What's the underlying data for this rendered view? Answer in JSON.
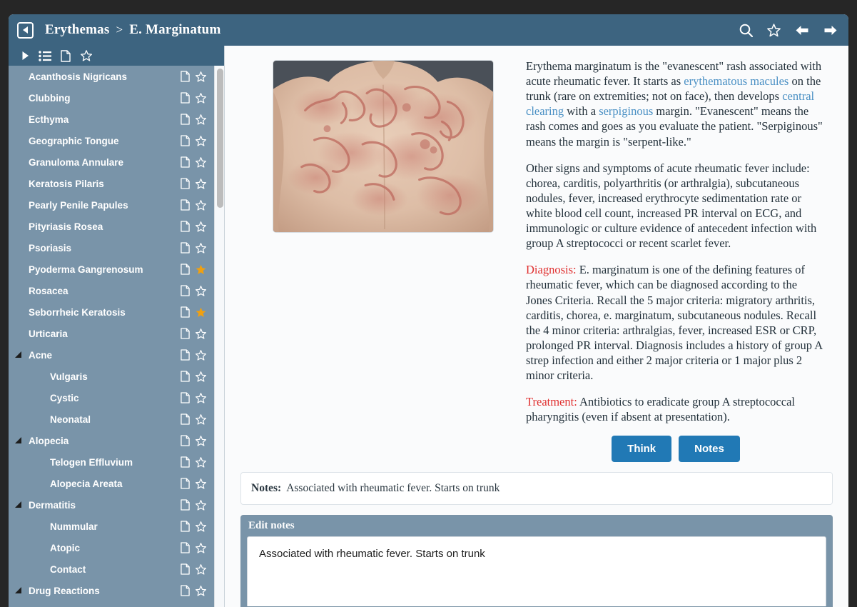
{
  "window": {
    "back_icon": "back-arrow-boxed-icon",
    "breadcrumb": {
      "parent": "Erythemas",
      "separator": ">",
      "current": "E. Marginatum"
    },
    "header_icons": [
      "search-icon",
      "star-icon",
      "arrow-left-icon",
      "arrow-right-icon"
    ],
    "accent": "#3d6480",
    "sidebar_bg": "#7994a9",
    "button_blue": "#2179b5",
    "star_gold": "#f0a010",
    "link_blue": "#4a90c4",
    "keyword_red": "#e03030"
  },
  "sidebar": {
    "toolbar_icons": [
      "expand-triangle-icon",
      "list-icon",
      "document-icon",
      "star-icon"
    ],
    "items": [
      {
        "label": "Acanthosis Nigricans",
        "level": 0,
        "expandable": false,
        "starred": false
      },
      {
        "label": "Clubbing",
        "level": 0,
        "expandable": false,
        "starred": false
      },
      {
        "label": "Ecthyma",
        "level": 0,
        "expandable": false,
        "starred": false
      },
      {
        "label": "Geographic Tongue",
        "level": 0,
        "expandable": false,
        "starred": false
      },
      {
        "label": "Granuloma Annulare",
        "level": 0,
        "expandable": false,
        "starred": false
      },
      {
        "label": "Keratosis Pilaris",
        "level": 0,
        "expandable": false,
        "starred": false
      },
      {
        "label": "Pearly Penile Papules",
        "level": 0,
        "expandable": false,
        "starred": false
      },
      {
        "label": "Pityriasis Rosea",
        "level": 0,
        "expandable": false,
        "starred": false
      },
      {
        "label": "Psoriasis",
        "level": 0,
        "expandable": false,
        "starred": false
      },
      {
        "label": "Pyoderma Gangrenosum",
        "level": 0,
        "expandable": false,
        "starred": true
      },
      {
        "label": "Rosacea",
        "level": 0,
        "expandable": false,
        "starred": false
      },
      {
        "label": "Seborrheic Keratosis",
        "level": 0,
        "expandable": false,
        "starred": true
      },
      {
        "label": "Urticaria",
        "level": 0,
        "expandable": false,
        "starred": false
      },
      {
        "label": "Acne",
        "level": 0,
        "expandable": true,
        "starred": false
      },
      {
        "label": "Vulgaris",
        "level": 1,
        "expandable": false,
        "starred": false
      },
      {
        "label": "Cystic",
        "level": 1,
        "expandable": false,
        "starred": false
      },
      {
        "label": "Neonatal",
        "level": 1,
        "expandable": false,
        "starred": false
      },
      {
        "label": "Alopecia",
        "level": 0,
        "expandable": true,
        "starred": false
      },
      {
        "label": "Telogen Effluvium",
        "level": 1,
        "expandable": false,
        "starred": false
      },
      {
        "label": "Alopecia Areata",
        "level": 1,
        "expandable": false,
        "starred": false
      },
      {
        "label": "Dermatitis",
        "level": 0,
        "expandable": true,
        "starred": false
      },
      {
        "label": "Nummular",
        "level": 1,
        "expandable": false,
        "starred": false
      },
      {
        "label": "Atopic",
        "level": 1,
        "expandable": false,
        "starred": false
      },
      {
        "label": "Contact",
        "level": 1,
        "expandable": false,
        "starred": false
      },
      {
        "label": "Drug Reactions",
        "level": 0,
        "expandable": true,
        "starred": false
      }
    ]
  },
  "main": {
    "photo_alt": "clinical-photo-erythema-marginatum-back",
    "paragraphs": {
      "p1_a": "Erythema marginatum is the \"evanescent\" rash associated with acute rheumatic fever. It starts as ",
      "p1_link1": "erythematous macules",
      "p1_b": " on the trunk (rare on extremities; not on face), then develops ",
      "p1_link2": "central clearing",
      "p1_c": " with a ",
      "p1_link3": "serpiginous",
      "p1_d": " margin. \"Evanescent\" means the rash comes and goes as you evaluate the patient. \"Serpiginous\" means the margin is \"serpent-like.\"",
      "p2": "Other signs and symptoms of acute rheumatic fever include: chorea, carditis, polyarthritis (or arthralgia), subcutaneous nodules, fever, increased erythrocyte sedimentation rate or white blood cell count, increased PR interval on ECG, and immunologic or culture evidence of antecedent infection with group A streptococci or recent scarlet fever.",
      "p3_label": "Diagnosis:",
      "p3": " E. marginatum is one of the defining features of rheumatic fever, which can be diagnosed according to the Jones Criteria. Recall the 5 major criteria: migratory arthritis, carditis, chorea, e. marginatum, subcutaneous nodules. Recall the 4 minor criteria: arthralgias, fever, increased ESR or CRP, prolonged PR interval. Diagnosis includes a history of group A strep infection and either 2 major criteria or 1 major plus 2 minor criteria.",
      "p4_label": "Treatment:",
      "p4": " Antibiotics to eradicate group A streptococcal pharyngitis (even if absent at presentation)."
    },
    "think_button": "Think",
    "notes_button": "Notes"
  },
  "notes": {
    "display_label": "Notes:",
    "display_value": "Associated with rheumatic fever. Starts on trunk",
    "editor_title": "Edit notes",
    "editor_value": "Associated with rheumatic fever. Starts on trunk"
  }
}
